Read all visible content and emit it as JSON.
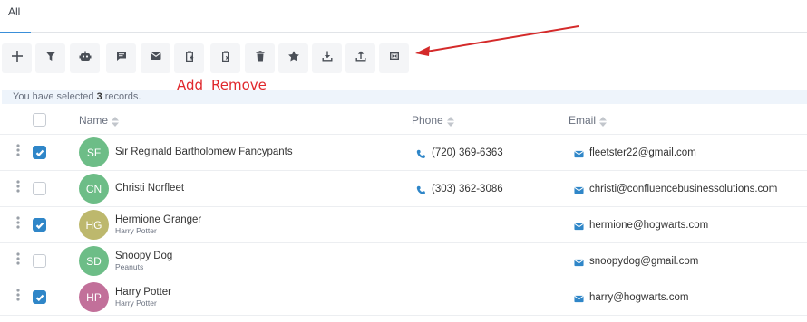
{
  "tabs": [
    {
      "label": "All"
    }
  ],
  "toolbar": {
    "buttons": [
      {
        "icon": "plus-icon"
      },
      {
        "icon": "filter-icon"
      },
      {
        "icon": "robot-icon"
      },
      {
        "icon": "chat-icon"
      },
      {
        "icon": "mail-icon"
      },
      {
        "icon": "clipboard-add-icon"
      },
      {
        "icon": "clipboard-remove-icon"
      },
      {
        "icon": "trash-icon"
      },
      {
        "icon": "star-icon"
      },
      {
        "icon": "download-icon"
      },
      {
        "icon": "upload-icon"
      },
      {
        "icon": "merge-icon"
      }
    ]
  },
  "annotations": {
    "add": "Add",
    "remove": "Remove",
    "arrow_color": "#d42a2a"
  },
  "selection": {
    "prefix": "You have selected ",
    "count": "3",
    "suffix": " records."
  },
  "columns": {
    "name": "Name",
    "phone": "Phone",
    "email": "Email"
  },
  "rows": [
    {
      "initials": "SF",
      "color": "#6dbd87",
      "name": "Sir Reginald Bartholomew Fancypants",
      "sub": "",
      "phone": "(720) 369-6363",
      "email": "fleetster22@gmail.com",
      "checked": true
    },
    {
      "initials": "CN",
      "color": "#6dbd87",
      "name": "Christi Norfleet",
      "sub": "",
      "phone": "(303) 362-3086",
      "email": "christi@confluencebusinessolutions.com",
      "checked": false
    },
    {
      "initials": "HG",
      "color": "#bdb86d",
      "name": "Hermione Granger",
      "sub": "Harry Potter",
      "phone": "",
      "email": "hermione@hogwarts.com",
      "checked": true
    },
    {
      "initials": "SD",
      "color": "#6dbd87",
      "name": "Snoopy Dog",
      "sub": "Peanuts",
      "phone": "",
      "email": "snoopydog@gmail.com",
      "checked": false
    },
    {
      "initials": "HP",
      "color": "#c2709a",
      "name": "Harry Potter",
      "sub": "Harry Potter",
      "phone": "",
      "email": "harry@hogwarts.com",
      "checked": true
    }
  ],
  "colors": {
    "accent": "#2f86c8",
    "annotation": "#e0282c"
  }
}
